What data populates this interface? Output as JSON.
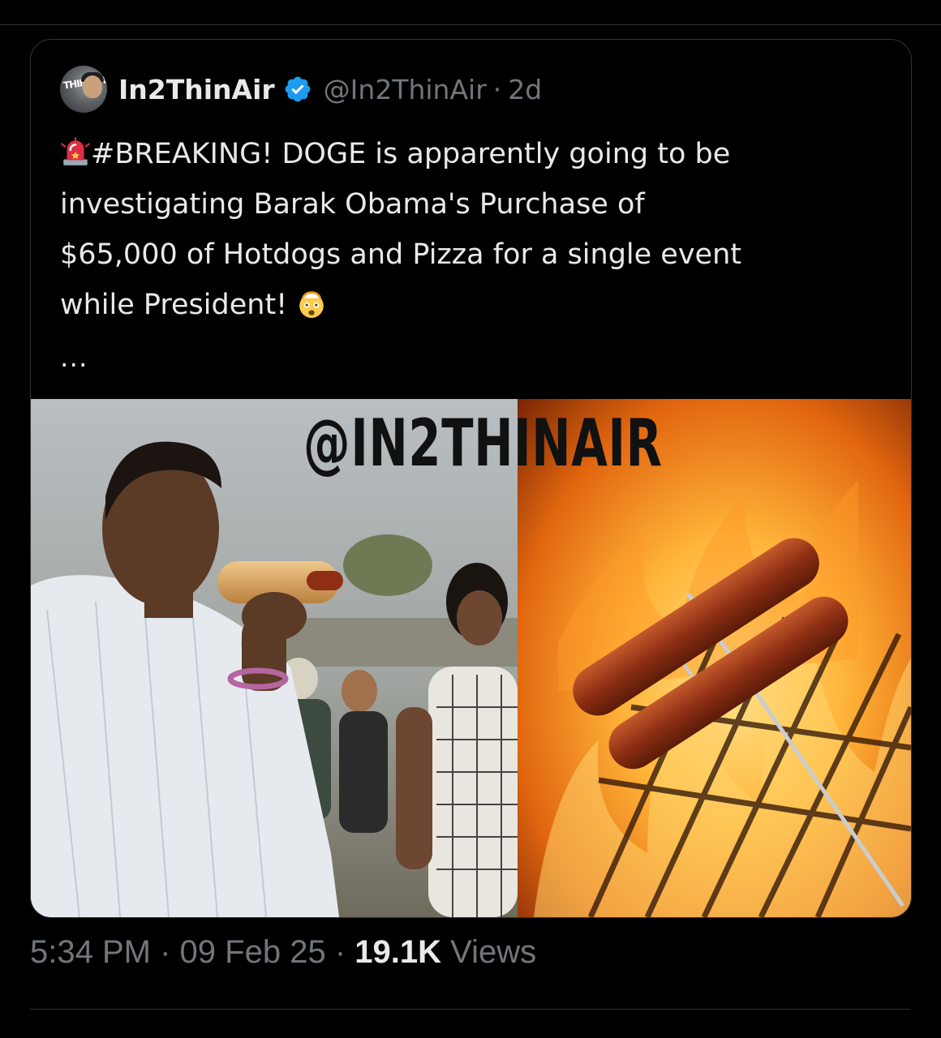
{
  "tweet": {
    "display_name": "In2ThinAir",
    "handle": "@In2ThinAir",
    "separator": "·",
    "time_ago": "2d",
    "verified_icon": "verified-badge-icon",
    "text_line_1": "#BREAKING! DOGE is apparently going to be",
    "text_line_2": "investigating Barak Obama's Purchase of",
    "text_line_3": "$65,000 of Hotdogs and Pizza for a single event",
    "text_line_4": "while President!",
    "leading_emoji": "police-light-emoji",
    "trailing_emoji": "exploding-head-emoji",
    "more_indicator": "...",
    "avatar_text": "THIN AIR"
  },
  "media": {
    "watermark": "@IN2THINAIR",
    "left_image": "man-eating-hotdog-photo",
    "right_image": "hotdogs-on-grill-photo"
  },
  "footer": {
    "time": "5:34 PM",
    "separator": "·",
    "date": "09 Feb 25",
    "views_count": "19.1K",
    "views_label": "Views"
  },
  "colors": {
    "background": "#000000",
    "text_primary": "#e7e9ea",
    "text_secondary": "#71767b",
    "border": "#2f3336",
    "verified_blue": "#1d9bf0"
  }
}
